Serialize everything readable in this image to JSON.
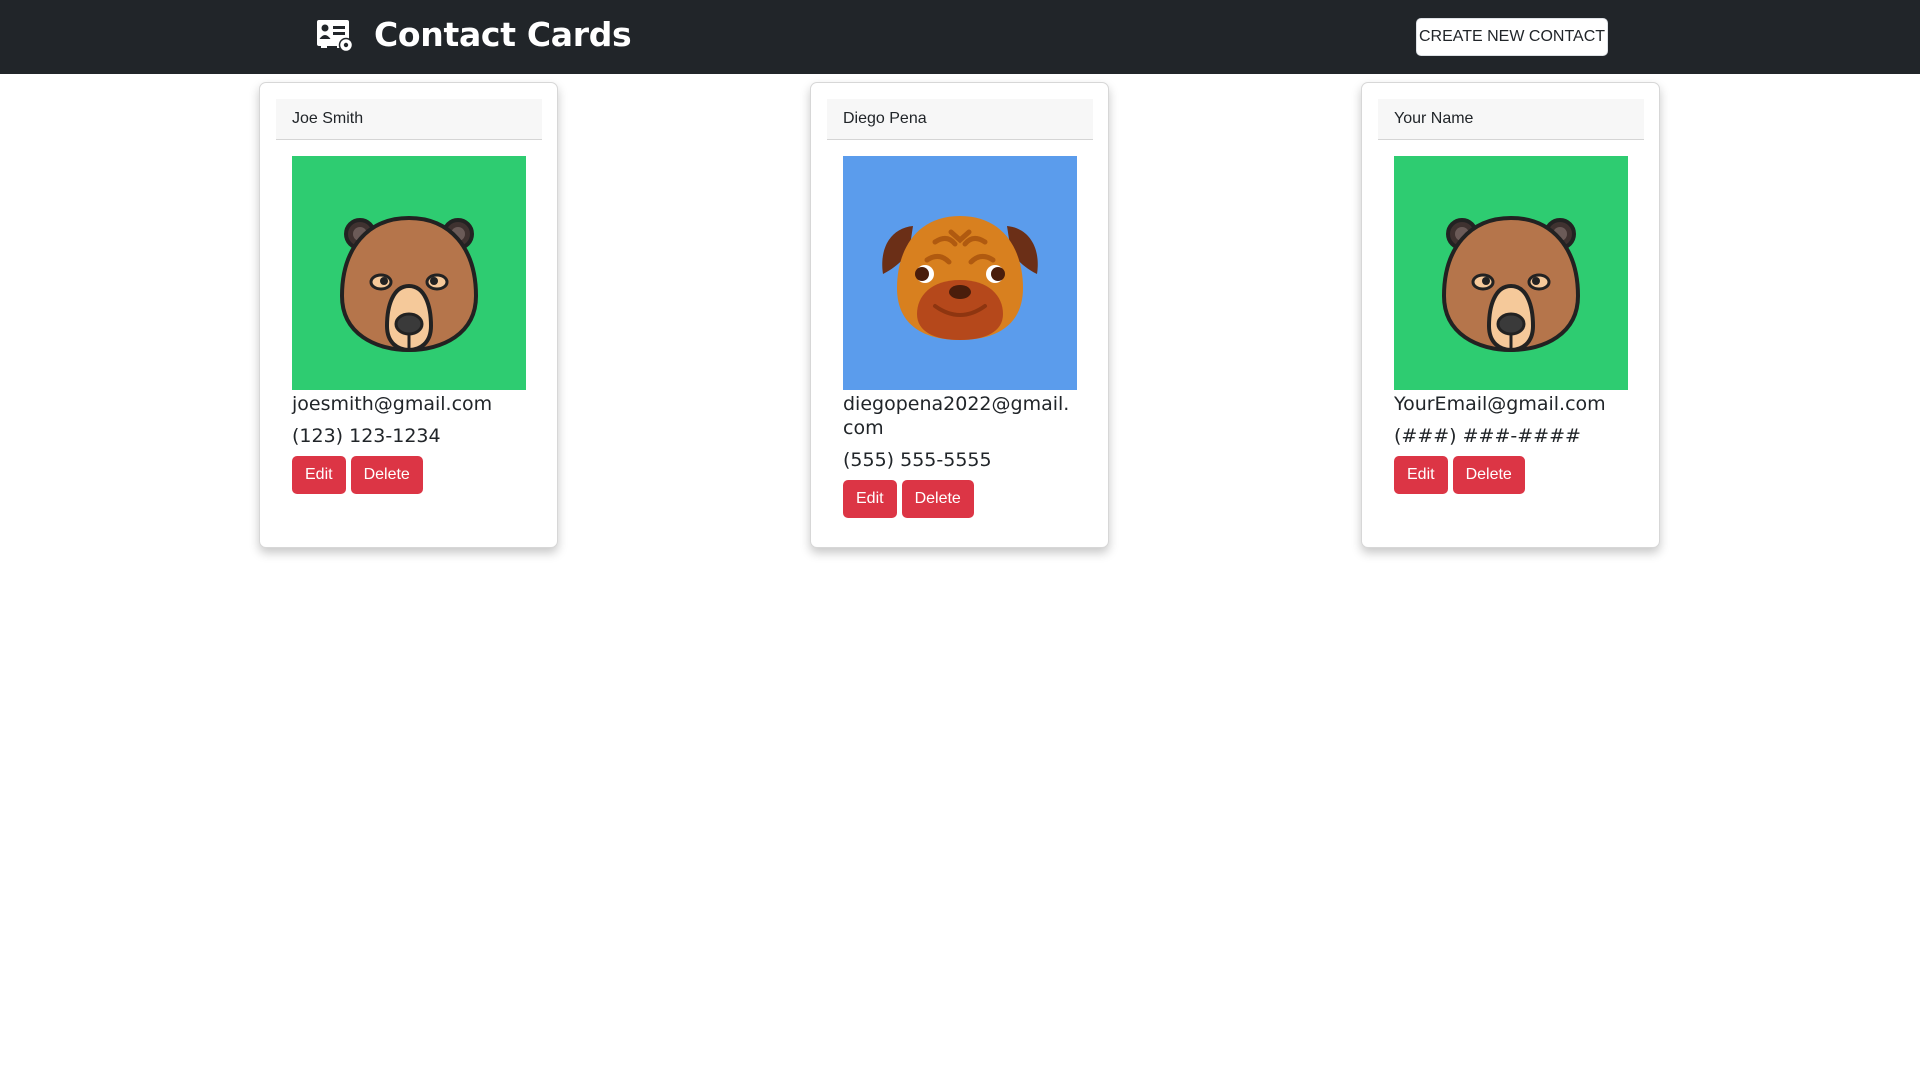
{
  "app": {
    "title": "Contact Cards",
    "icon": "contact-card-icon"
  },
  "header": {
    "create_button_label": "CREATE NEW CONTACT"
  },
  "colors": {
    "navbar": "#212529",
    "danger": "#dc3545",
    "bear_avatar_bg": "#2ecc71",
    "dog_avatar_bg": "#5b9cec"
  },
  "contacts": [
    {
      "name": "Joe Smith",
      "avatar": "bear-icon",
      "email": "joesmith@gmail.com",
      "phone": "(123) 123-1234",
      "edit_label": "Edit",
      "delete_label": "Delete"
    },
    {
      "name": "Diego Pena",
      "avatar": "pug-dog-icon",
      "email": "diegopena2022@gmail.com",
      "phone": "(555) 555-5555",
      "edit_label": "Edit",
      "delete_label": "Delete"
    },
    {
      "name": "Your Name",
      "avatar": "bear-icon",
      "email": "YourEmail@gmail.com",
      "phone": "(###) ###-####",
      "edit_label": "Edit",
      "delete_label": "Delete"
    }
  ]
}
